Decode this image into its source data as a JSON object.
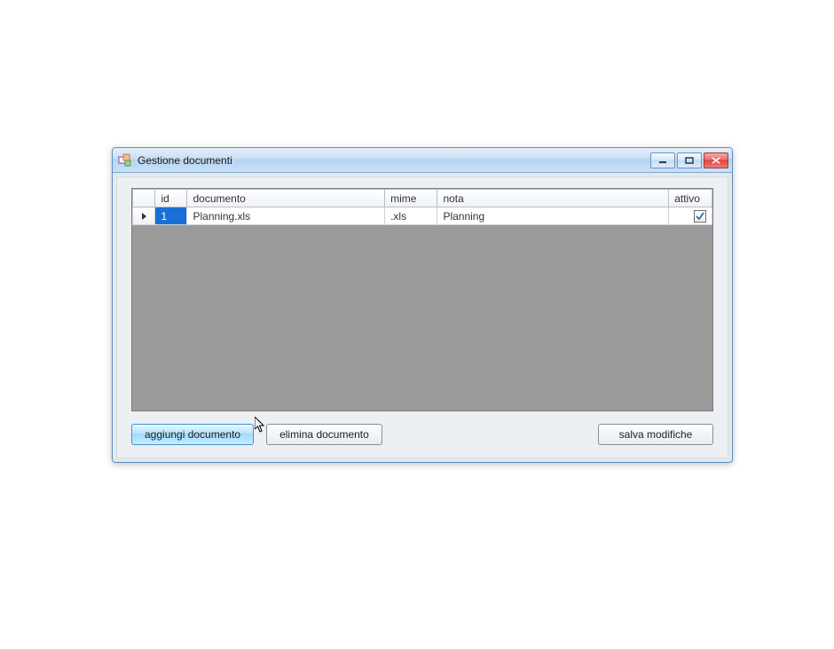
{
  "window": {
    "title": "Gestione documenti"
  },
  "grid": {
    "headers": {
      "id": "id",
      "documento": "documento",
      "mime": "mime",
      "nota": "nota",
      "attivo": "attivo"
    },
    "rows": [
      {
        "id": "1",
        "documento": "Planning.xls",
        "mime": ".xls",
        "nota": "Planning",
        "attivo": true
      }
    ]
  },
  "buttons": {
    "add": "aggiungi documento",
    "delete": "elimina documento",
    "save": "salva modifiche"
  }
}
